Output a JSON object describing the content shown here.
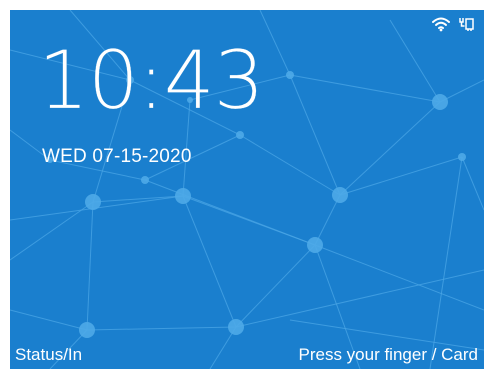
{
  "screen": {
    "background_color": "#1a7fce",
    "accent_color": "#4eaae8"
  },
  "status_bar": {
    "icons": [
      "wifi-icon",
      "ethernet-icon"
    ]
  },
  "clock": {
    "time": "10:43",
    "date": "WED 07-15-2020"
  },
  "footer": {
    "left_label": "Status/In",
    "right_label": "Press your finger / Card"
  }
}
